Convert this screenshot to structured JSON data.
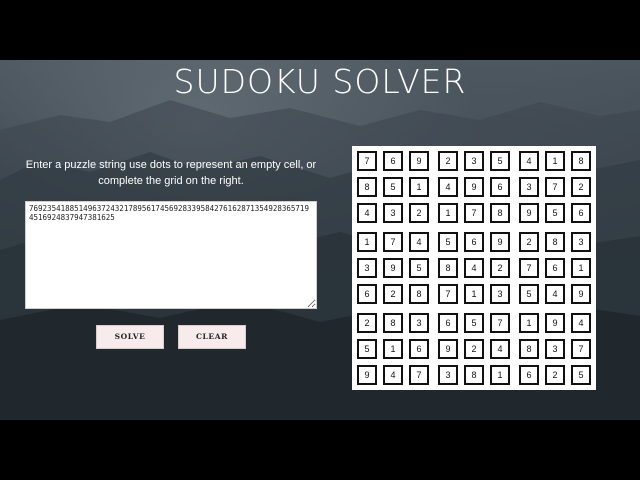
{
  "page": {
    "title": "SUDOKU SOLVER",
    "instructions": "Enter a puzzle string use dots to represent an empty cell, or complete the grid on the right."
  },
  "input": {
    "value": "769235418851496372432178956174569283395842761628713549283657194516924837947381625"
  },
  "buttons": {
    "solve": "SOLVE",
    "clear": "CLEAR"
  },
  "colors": {
    "button_bg": "#f7eceb",
    "title": "#ffffff",
    "grid_border": "#111111"
  },
  "grid": {
    "rows": [
      [
        "7",
        "6",
        "9",
        "2",
        "3",
        "5",
        "4",
        "1",
        "8"
      ],
      [
        "8",
        "5",
        "1",
        "4",
        "9",
        "6",
        "3",
        "7",
        "2"
      ],
      [
        "4",
        "3",
        "2",
        "1",
        "7",
        "8",
        "9",
        "5",
        "6"
      ],
      [
        "1",
        "7",
        "4",
        "5",
        "6",
        "9",
        "2",
        "8",
        "3"
      ],
      [
        "3",
        "9",
        "5",
        "8",
        "4",
        "2",
        "7",
        "6",
        "1"
      ],
      [
        "6",
        "2",
        "8",
        "7",
        "1",
        "3",
        "5",
        "4",
        "9"
      ],
      [
        "2",
        "8",
        "3",
        "6",
        "5",
        "7",
        "1",
        "9",
        "4"
      ],
      [
        "5",
        "1",
        "6",
        "9",
        "2",
        "4",
        "8",
        "3",
        "7"
      ],
      [
        "9",
        "4",
        "7",
        "3",
        "8",
        "1",
        "6",
        "2",
        "5"
      ]
    ]
  }
}
